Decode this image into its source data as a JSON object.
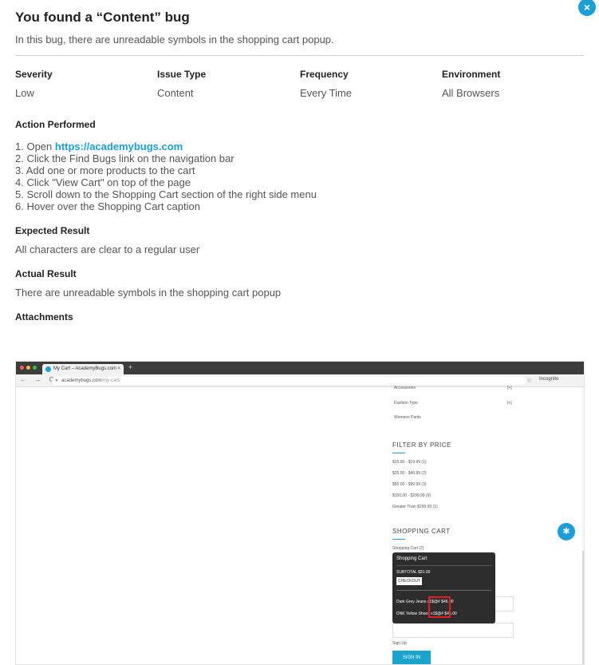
{
  "title": "You found a “Content” bug",
  "subtitle": "In this bug, there are unreadable symbols in the shopping cart popup.",
  "meta": [
    {
      "label": "Severity",
      "value": "Low"
    },
    {
      "label": "Issue Type",
      "value": "Content"
    },
    {
      "label": "Frequency",
      "value": "Every Time"
    },
    {
      "label": "Environment",
      "value": "All Browsers"
    }
  ],
  "action": {
    "label": "Action Performed",
    "step1_prefix": "1. Open ",
    "step1_link": "https://academybugs.com",
    "steps": [
      "2. Click the Find Bugs link on the navigation bar",
      "3. Add one or more products to the cart",
      "4. Click \"View Cart\" on top of the page",
      "5. Scroll down to the Shopping Cart section of the right side menu",
      "6. Hover over the Shopping Cart caption"
    ]
  },
  "expected": {
    "label": "Expected Result",
    "text": "All characters are clear to a regular user"
  },
  "actual": {
    "label": "Actual Result",
    "text": "There are unreadable symbols in the shopping cart popup"
  },
  "attachments_label": "Attachments",
  "close_glyph": "×",
  "screenshot": {
    "tab_title": "My Cart – AcademyBugs.com",
    "tab_close": "×",
    "new_tab": "+",
    "nav": "← → C",
    "url_host": "academybugs.com",
    "url_path": "/my-cart/",
    "star": "☆",
    "incognito": "Incognito",
    "sidebar": {
      "accessories": "Accessories",
      "accessories_toggle": "[+]",
      "fashion": "Fashion Type",
      "fashion_toggle": "[+]",
      "womens": "Womens Pants"
    },
    "filter_heading": "FILTER BY PRICE",
    "price_ranges": [
      "$15.00 - $19.99 (1)",
      "$25.00 - $49.99 (2)",
      "$50.00 - $99.99 (3)",
      "$100.00 - $299.99 (9)",
      "Greater Than $299.99 (1)"
    ],
    "cart_heading": "SHOPPING CART",
    "cart_link": "Shopping Cart (2)",
    "popup": {
      "title": "Shopping Cart",
      "subtotal": "SUBTOTAL  $91.00",
      "checkout": "CHECKOUT",
      "items": [
        {
          "name": "Dark Grey Jeans",
          "qty": "x1$@#",
          "price": "$46.00"
        },
        {
          "name": "DNK Yellow Shoes",
          "qty": "x1$@#",
          "price": "$45.00"
        }
      ]
    },
    "signup": "Sign Up",
    "signin": "SIGN IN"
  },
  "colors": {
    "accent": "#1a9fd9",
    "highlight": "#e02020"
  }
}
